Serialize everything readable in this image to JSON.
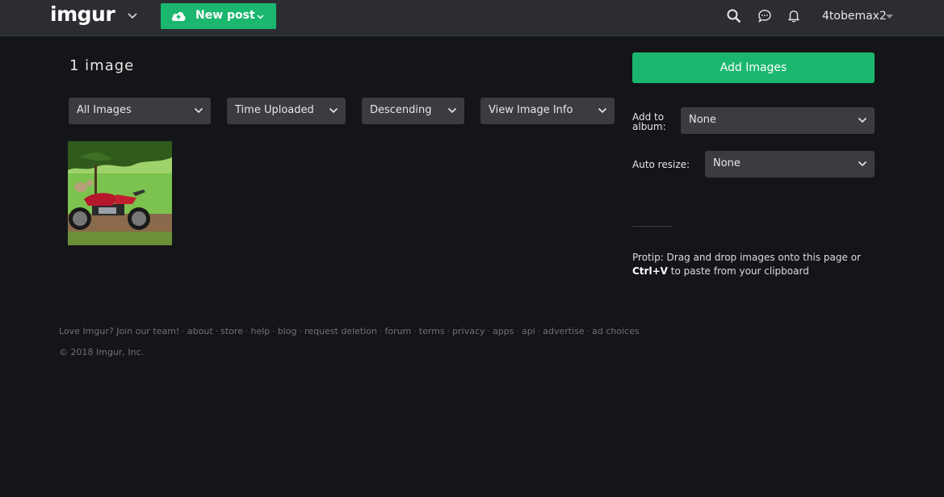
{
  "header": {
    "logo_text": "imgur",
    "new_post_label": "New post",
    "username": "4tobemax2",
    "icons": [
      "chevron-down-icon",
      "upload-cloud-icon",
      "search-icon",
      "chat-icon",
      "bell-icon"
    ]
  },
  "main": {
    "image_count_label": "1 image",
    "filters": {
      "scope": "All Images",
      "sort": "Time Uploaded",
      "order": "Descending",
      "view": "View Image Info"
    },
    "thumbnail_alt": "motorcycle photo with a small animal"
  },
  "sidebar": {
    "add_images_label": "Add Images",
    "add_to_album_label": "Add to album:",
    "add_to_album_value": "None",
    "auto_resize_label": "Auto resize:",
    "auto_resize_value": "None",
    "protip_text": "Protip: Drag and drop images onto this page or",
    "protip_shortcut": "Ctrl+V",
    "protip_suffix": "to paste from your clipboard"
  },
  "footer": {
    "links": [
      "Love Imgur? Join our team!",
      "about",
      "store",
      "help",
      "blog",
      "request deletion",
      "forum",
      "terms",
      "privacy",
      "apps",
      "api",
      "advertise",
      "ad choices"
    ],
    "copyright": "© 2018 Imgur, Inc."
  },
  "colors": {
    "background": "#141518",
    "topbar": "#2b2d33",
    "accent_green": "#1bb76e",
    "control_bg": "#3a3c42"
  }
}
